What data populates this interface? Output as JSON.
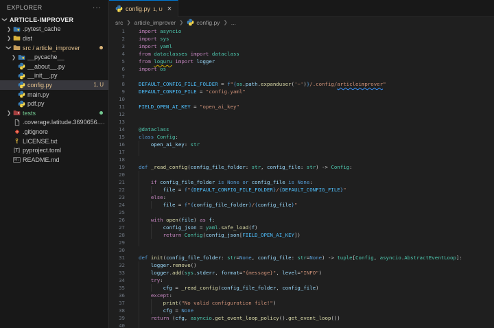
{
  "colors": {
    "editor_bg": "#1f1f1f",
    "sidebar_bg": "#181818",
    "border": "#2b2b2b",
    "selected_row_bg": "#37373d",
    "modified_gold": "#e2c08d",
    "added_green": "#73c991",
    "active_tab_top_border": "#0078d4",
    "line_number": "#6e7681"
  },
  "sidebar": {
    "header": {
      "title": "EXPLORER",
      "actions": "···"
    },
    "items": [
      {
        "label": "ARTICLE-IMPROVER",
        "level": 0,
        "chevron": "expanded",
        "icon": "none",
        "bold": true
      },
      {
        "label": ".pytest_cache",
        "level": 1,
        "chevron": "collapsed",
        "icon": "python-folder"
      },
      {
        "label": "dist",
        "level": 1,
        "chevron": "collapsed",
        "icon": "folder-yellow"
      },
      {
        "label": "src / article_improver",
        "level": 1,
        "chevron": "expanded",
        "icon": "folder-tan",
        "color": "#e2c08d",
        "dot": "#dcb67a"
      },
      {
        "label": "__pycache__",
        "level": 2,
        "chevron": "collapsed",
        "icon": "python-folder"
      },
      {
        "label": "__about__.py",
        "level": 2,
        "icon": "python"
      },
      {
        "label": "__init__.py",
        "level": 2,
        "icon": "python"
      },
      {
        "label": "config.py",
        "level": 2,
        "icon": "python",
        "selected": true,
        "color": "#e2c08d",
        "badge": "1, U"
      },
      {
        "label": "main.py",
        "level": 2,
        "icon": "python"
      },
      {
        "label": "pdf.py",
        "level": 2,
        "icon": "python"
      },
      {
        "label": "tests",
        "level": 1,
        "chevron": "collapsed",
        "icon": "folder-test",
        "color": "#73c991",
        "dot": "#73c991"
      },
      {
        "label": ".coverage.latitude.3690656.XHOa...",
        "level": 1,
        "icon": "file"
      },
      {
        "label": ".gitignore",
        "level": 1,
        "icon": "git"
      },
      {
        "label": "LICENSE.txt",
        "level": 1,
        "icon": "key"
      },
      {
        "label": "pyproject.toml",
        "level": 1,
        "icon": "toml"
      },
      {
        "label": "README.md",
        "level": 1,
        "icon": "markdown"
      }
    ]
  },
  "editor": {
    "tab": {
      "label": "config.py",
      "badge": "1, U",
      "close": "×"
    },
    "breadcrumb": [
      {
        "label": "src"
      },
      {
        "label": "article_improver"
      },
      {
        "label": "config.py",
        "icon": "python"
      },
      {
        "label": "..."
      }
    ],
    "lines": [
      {
        "n": 1,
        "t": [
          [
            "k",
            "import"
          ],
          [
            "w",
            " "
          ],
          [
            "t",
            "asyncio"
          ]
        ]
      },
      {
        "n": 2,
        "t": [
          [
            "k",
            "import"
          ],
          [
            "w",
            " "
          ],
          [
            "t",
            "sys"
          ]
        ]
      },
      {
        "n": 3,
        "t": [
          [
            "k",
            "import"
          ],
          [
            "w",
            " "
          ],
          [
            "t",
            "yaml"
          ]
        ]
      },
      {
        "n": 4,
        "t": [
          [
            "k",
            "from"
          ],
          [
            "w",
            " "
          ],
          [
            "t",
            "dataclasses"
          ],
          [
            "w",
            " "
          ],
          [
            "k",
            "import"
          ],
          [
            "w",
            " "
          ],
          [
            "t",
            "dataclass"
          ]
        ]
      },
      {
        "n": 5,
        "t": [
          [
            "k",
            "from"
          ],
          [
            "w",
            " "
          ],
          [
            "u",
            "loguru"
          ],
          [
            "w",
            " "
          ],
          [
            "k",
            "import"
          ],
          [
            "w",
            " "
          ],
          [
            "v",
            "logger"
          ]
        ]
      },
      {
        "n": 6,
        "t": [
          [
            "k",
            "import"
          ],
          [
            "w",
            " "
          ],
          [
            "t",
            "os"
          ]
        ]
      },
      {
        "n": 7,
        "t": []
      },
      {
        "n": 8,
        "t": [
          [
            "c",
            "DEFAULT_CONFIG_FILE_FOLDER"
          ],
          [
            "w",
            " = "
          ],
          [
            "b",
            "f"
          ],
          [
            "s",
            "\""
          ],
          [
            "b",
            "{"
          ],
          [
            "t",
            "os"
          ],
          [
            "w",
            "."
          ],
          [
            "v",
            "path"
          ],
          [
            "w",
            "."
          ],
          [
            "f",
            "expanduser"
          ],
          [
            "w",
            "("
          ],
          [
            "s",
            "'~'"
          ],
          [
            "w",
            ")"
          ],
          [
            "b",
            "}"
          ],
          [
            "s",
            "/.config/"
          ],
          [
            "q",
            "articleimprover"
          ],
          [
            "s",
            "\""
          ]
        ]
      },
      {
        "n": 9,
        "t": [
          [
            "c",
            "DEFAULT_CONFIG_FILE"
          ],
          [
            "w",
            " = "
          ],
          [
            "s",
            "\"config.yaml\""
          ]
        ]
      },
      {
        "n": 10,
        "t": []
      },
      {
        "n": 11,
        "t": [
          [
            "c",
            "FIELD_OPEN_AI_KEY"
          ],
          [
            "w",
            " = "
          ],
          [
            "s",
            "\"open_ai_key\""
          ]
        ]
      },
      {
        "n": 12,
        "t": []
      },
      {
        "n": 13,
        "t": []
      },
      {
        "n": 14,
        "t": [
          [
            "t",
            "@dataclass"
          ]
        ]
      },
      {
        "n": 15,
        "t": [
          [
            "b",
            "class"
          ],
          [
            "w",
            " "
          ],
          [
            "t",
            "Config"
          ],
          [
            "w",
            ":"
          ]
        ]
      },
      {
        "n": 16,
        "t": [
          [
            "w",
            "    "
          ],
          [
            "v",
            "open_ai_key"
          ],
          [
            "w",
            ": "
          ],
          [
            "t",
            "str"
          ]
        ],
        "g": [
          0
        ]
      },
      {
        "n": 17,
        "t": [],
        "g": [
          0
        ]
      },
      {
        "n": 18,
        "t": []
      },
      {
        "n": 19,
        "t": [
          [
            "b",
            "def"
          ],
          [
            "w",
            " "
          ],
          [
            "f",
            "_read_config"
          ],
          [
            "w",
            "("
          ],
          [
            "v",
            "config_file_folder"
          ],
          [
            "w",
            ": "
          ],
          [
            "t",
            "str"
          ],
          [
            "w",
            ", "
          ],
          [
            "v",
            "config_file"
          ],
          [
            "w",
            ": "
          ],
          [
            "t",
            "str"
          ],
          [
            "w",
            ") -> "
          ],
          [
            "t",
            "Config"
          ],
          [
            "w",
            ":"
          ]
        ]
      },
      {
        "n": 20,
        "t": [],
        "g": [
          0
        ]
      },
      {
        "n": 21,
        "t": [
          [
            "w",
            "    "
          ],
          [
            "k",
            "if"
          ],
          [
            "w",
            " "
          ],
          [
            "v",
            "config_file_folder"
          ],
          [
            "w",
            " "
          ],
          [
            "b",
            "is"
          ],
          [
            "w",
            " "
          ],
          [
            "b",
            "None"
          ],
          [
            "w",
            " "
          ],
          [
            "b",
            "or"
          ],
          [
            "w",
            " "
          ],
          [
            "v",
            "config_file"
          ],
          [
            "w",
            " "
          ],
          [
            "b",
            "is"
          ],
          [
            "w",
            " "
          ],
          [
            "b",
            "None"
          ],
          [
            "w",
            ":"
          ]
        ],
        "g": [
          0
        ]
      },
      {
        "n": 22,
        "t": [
          [
            "w",
            "        "
          ],
          [
            "v",
            "file"
          ],
          [
            "w",
            " = "
          ],
          [
            "b",
            "f"
          ],
          [
            "s",
            "\""
          ],
          [
            "b",
            "{"
          ],
          [
            "c",
            "DEFAULT_CONFIG_FILE_FOLDER"
          ],
          [
            "b",
            "}"
          ],
          [
            "s",
            "/"
          ],
          [
            "b",
            "{"
          ],
          [
            "c",
            "DEFAULT_CONFIG_FILE"
          ],
          [
            "b",
            "}"
          ],
          [
            "s",
            "\""
          ]
        ],
        "g": [
          0,
          4
        ]
      },
      {
        "n": 23,
        "t": [
          [
            "w",
            "    "
          ],
          [
            "k",
            "else"
          ],
          [
            "w",
            ":"
          ]
        ],
        "g": [
          0
        ]
      },
      {
        "n": 24,
        "t": [
          [
            "w",
            "        "
          ],
          [
            "v",
            "file"
          ],
          [
            "w",
            " = "
          ],
          [
            "b",
            "f"
          ],
          [
            "s",
            "\""
          ],
          [
            "b",
            "{"
          ],
          [
            "v",
            "config_file_folder"
          ],
          [
            "b",
            "}"
          ],
          [
            "s",
            "/"
          ],
          [
            "b",
            "{"
          ],
          [
            "v",
            "config_file"
          ],
          [
            "b",
            "}"
          ],
          [
            "s",
            "\""
          ]
        ],
        "g": [
          0,
          4
        ]
      },
      {
        "n": 25,
        "t": [],
        "g": [
          0
        ]
      },
      {
        "n": 26,
        "t": [
          [
            "w",
            "    "
          ],
          [
            "k",
            "with"
          ],
          [
            "w",
            " "
          ],
          [
            "f",
            "open"
          ],
          [
            "w",
            "("
          ],
          [
            "v",
            "file"
          ],
          [
            "w",
            ") "
          ],
          [
            "k",
            "as"
          ],
          [
            "w",
            " "
          ],
          [
            "v",
            "f"
          ],
          [
            "w",
            ":"
          ]
        ],
        "g": [
          0
        ]
      },
      {
        "n": 27,
        "t": [
          [
            "w",
            "        "
          ],
          [
            "v",
            "config_json"
          ],
          [
            "w",
            " = "
          ],
          [
            "t",
            "yaml"
          ],
          [
            "w",
            "."
          ],
          [
            "f",
            "safe_load"
          ],
          [
            "w",
            "("
          ],
          [
            "v",
            "f"
          ],
          [
            "w",
            ")"
          ]
        ],
        "g": [
          0,
          4
        ]
      },
      {
        "n": 28,
        "t": [
          [
            "w",
            "        "
          ],
          [
            "k",
            "return"
          ],
          [
            "w",
            " "
          ],
          [
            "t",
            "Config"
          ],
          [
            "w",
            "("
          ],
          [
            "v",
            "config_json"
          ],
          [
            "w",
            "["
          ],
          [
            "c",
            "FIELD_OPEN_AI_KEY"
          ],
          [
            "w",
            "])"
          ]
        ],
        "g": [
          0,
          4
        ]
      },
      {
        "n": 29,
        "t": [],
        "g": [
          0
        ]
      },
      {
        "n": 30,
        "t": []
      },
      {
        "n": 31,
        "t": [
          [
            "b",
            "def"
          ],
          [
            "w",
            " "
          ],
          [
            "f",
            "init"
          ],
          [
            "w",
            "("
          ],
          [
            "v",
            "config_file_folder"
          ],
          [
            "w",
            ": "
          ],
          [
            "t",
            "str"
          ],
          [
            "w",
            "="
          ],
          [
            "b",
            "None"
          ],
          [
            "w",
            ", "
          ],
          [
            "v",
            "config_file"
          ],
          [
            "w",
            ": "
          ],
          [
            "t",
            "str"
          ],
          [
            "w",
            "="
          ],
          [
            "b",
            "None"
          ],
          [
            "w",
            ") -> "
          ],
          [
            "t",
            "tuple"
          ],
          [
            "w",
            "["
          ],
          [
            "t",
            "Config"
          ],
          [
            "w",
            ", "
          ],
          [
            "t",
            "asyncio"
          ],
          [
            "w",
            "."
          ],
          [
            "t",
            "AbstractEventLoop"
          ],
          [
            "w",
            "]:"
          ]
        ]
      },
      {
        "n": 32,
        "t": [
          [
            "w",
            "    "
          ],
          [
            "v",
            "logger"
          ],
          [
            "w",
            "."
          ],
          [
            "f",
            "remove"
          ],
          [
            "w",
            "()"
          ]
        ],
        "g": [
          0
        ]
      },
      {
        "n": 33,
        "t": [
          [
            "w",
            "    "
          ],
          [
            "v",
            "logger"
          ],
          [
            "w",
            "."
          ],
          [
            "f",
            "add"
          ],
          [
            "w",
            "("
          ],
          [
            "t",
            "sys"
          ],
          [
            "w",
            "."
          ],
          [
            "v",
            "stderr"
          ],
          [
            "w",
            ", "
          ],
          [
            "v",
            "format"
          ],
          [
            "w",
            "="
          ],
          [
            "s",
            "\"{message}\""
          ],
          [
            "w",
            ", "
          ],
          [
            "v",
            "level"
          ],
          [
            "w",
            "="
          ],
          [
            "s",
            "\"INFO\""
          ],
          [
            "w",
            ")"
          ]
        ],
        "g": [
          0
        ]
      },
      {
        "n": 34,
        "t": [
          [
            "w",
            "    "
          ],
          [
            "k",
            "try"
          ],
          [
            "w",
            ":"
          ]
        ],
        "g": [
          0
        ]
      },
      {
        "n": 35,
        "t": [
          [
            "w",
            "        "
          ],
          [
            "v",
            "cfg"
          ],
          [
            "w",
            " = "
          ],
          [
            "f",
            "_read_config"
          ],
          [
            "w",
            "("
          ],
          [
            "v",
            "config_file_folder"
          ],
          [
            "w",
            ", "
          ],
          [
            "v",
            "config_file"
          ],
          [
            "w",
            ")"
          ]
        ],
        "g": [
          0,
          4
        ]
      },
      {
        "n": 36,
        "t": [
          [
            "w",
            "    "
          ],
          [
            "k",
            "except"
          ],
          [
            "w",
            ":"
          ]
        ],
        "g": [
          0
        ]
      },
      {
        "n": 37,
        "t": [
          [
            "w",
            "        "
          ],
          [
            "f",
            "print"
          ],
          [
            "w",
            "("
          ],
          [
            "s",
            "\"No valid configuration file!\""
          ],
          [
            "w",
            ")"
          ]
        ],
        "g": [
          0,
          4
        ]
      },
      {
        "n": 38,
        "t": [
          [
            "w",
            "        "
          ],
          [
            "v",
            "cfg"
          ],
          [
            "w",
            " = "
          ],
          [
            "b",
            "None"
          ]
        ],
        "g": [
          0,
          4
        ]
      },
      {
        "n": 39,
        "t": [
          [
            "w",
            "    "
          ],
          [
            "k",
            "return"
          ],
          [
            "w",
            " ("
          ],
          [
            "v",
            "cfg"
          ],
          [
            "w",
            ", "
          ],
          [
            "t",
            "asyncio"
          ],
          [
            "w",
            "."
          ],
          [
            "f",
            "get_event_loop_policy"
          ],
          [
            "w",
            "()."
          ],
          [
            "f",
            "get_event_loop"
          ],
          [
            "w",
            "())"
          ]
        ],
        "g": [
          0
        ]
      },
      {
        "n": 40,
        "t": [],
        "g": [
          0
        ]
      }
    ]
  }
}
